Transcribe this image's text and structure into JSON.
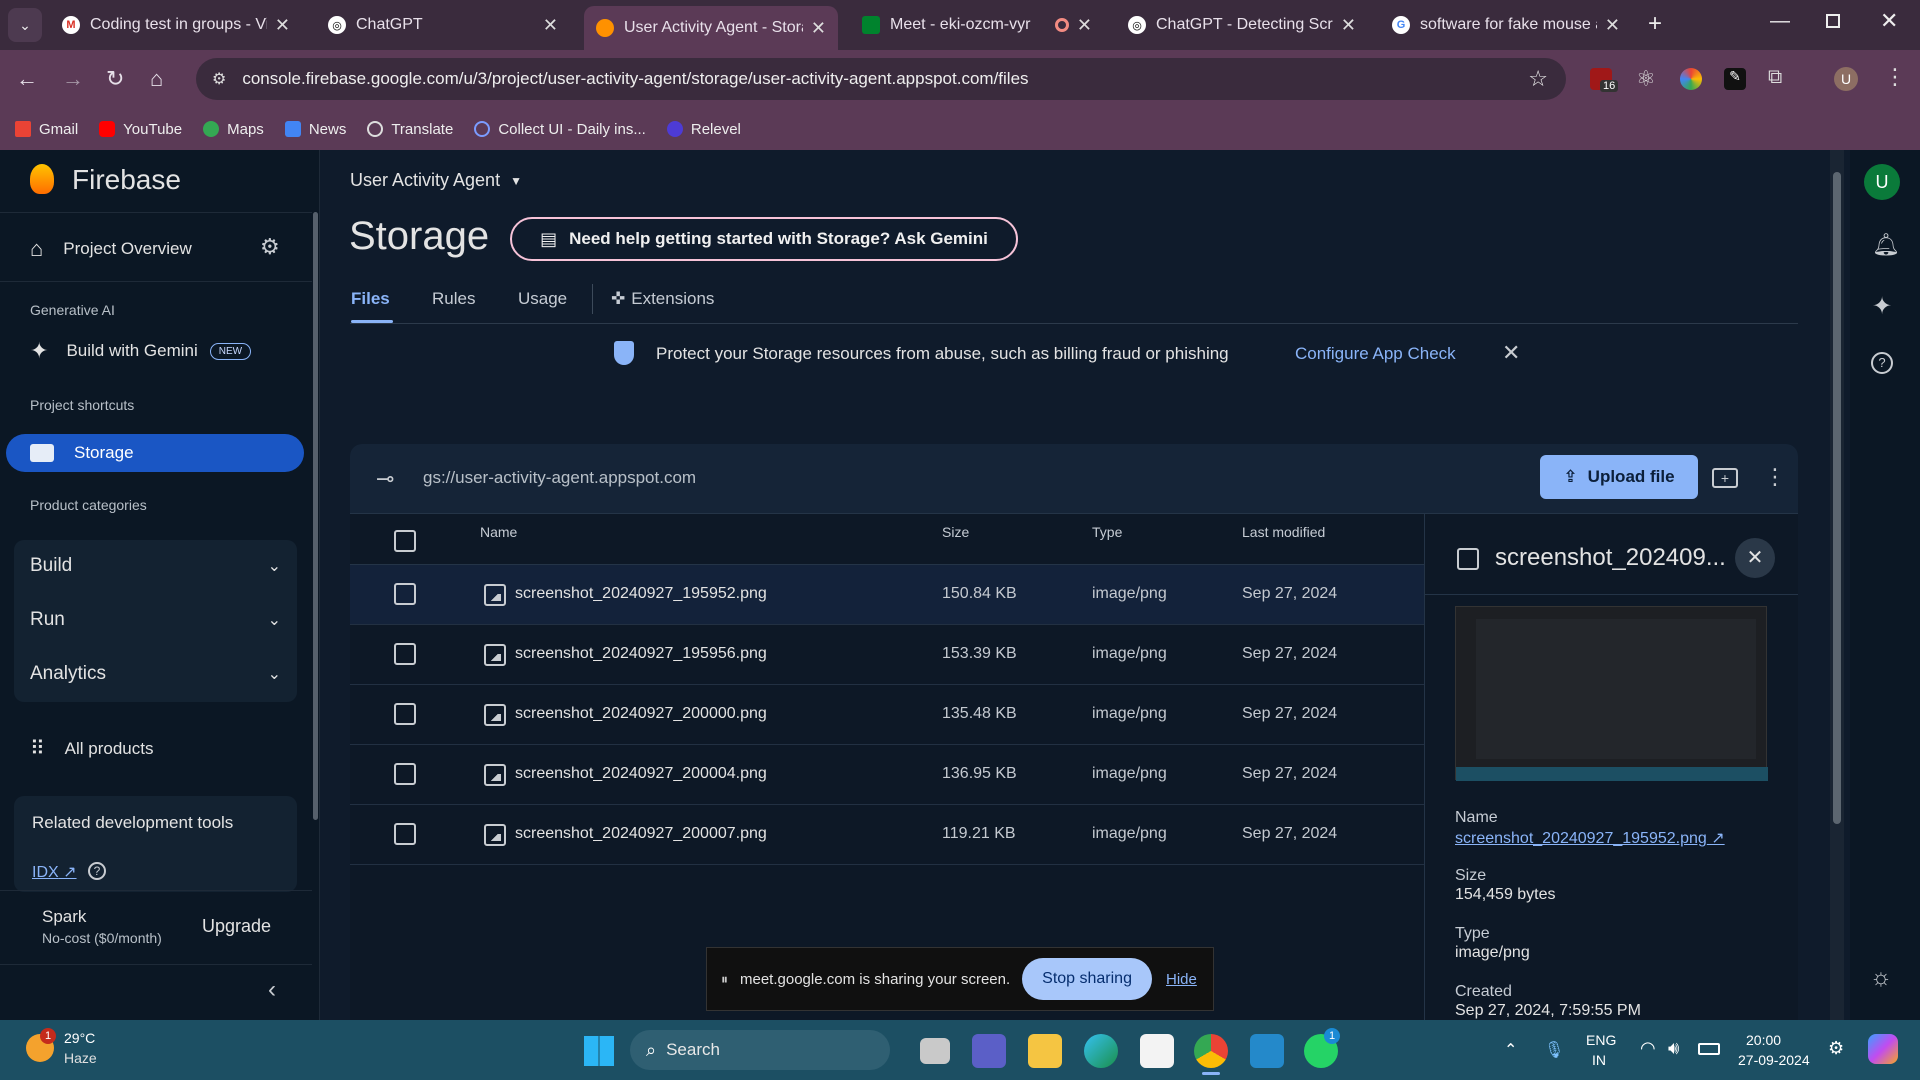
{
  "browser": {
    "tabs": [
      {
        "title": "Coding test in groups - Vin",
        "favicon": "gmail-icon",
        "active": false
      },
      {
        "title": "ChatGPT",
        "favicon": "chatgpt-icon",
        "active": false
      },
      {
        "title": "User Activity Agent - Stora",
        "favicon": "firebase-icon",
        "active": true
      },
      {
        "title": "Meet - eki-ozcm-vyr",
        "favicon": "meet-icon",
        "active": false
      },
      {
        "title": "ChatGPT - Detecting Script",
        "favicon": "chatgpt-icon",
        "active": false
      },
      {
        "title": "software for fake mouse an",
        "favicon": "google-icon",
        "active": false
      }
    ],
    "url": "console.firebase.google.com/u/3/project/user-activity-agent/storage/user-activity-agent.appspot.com/files",
    "extension_badge": "16",
    "profile_initial": "U",
    "bookmarks": [
      "Gmail",
      "YouTube",
      "Maps",
      "News",
      "Translate",
      "Collect UI - Daily ins...",
      "Relevel"
    ]
  },
  "sidebar": {
    "brand": "Firebase",
    "project_overview": "Project Overview",
    "generative_ai_heading": "Generative AI",
    "build_with_gemini": "Build with Gemini",
    "new_badge": "NEW",
    "project_shortcuts_heading": "Project shortcuts",
    "storage": "Storage",
    "product_categories_heading": "Product categories",
    "categories": [
      "Build",
      "Run",
      "Analytics"
    ],
    "all_products": "All products",
    "related_tools_heading": "Related development tools",
    "idx_link": "IDX",
    "plan_name": "Spark",
    "plan_desc": "No-cost ($0/month)",
    "upgrade": "Upgrade"
  },
  "header": {
    "project_name": "User Activity Agent",
    "page_title": "Storage",
    "gemini_help": "Need help getting started with Storage? Ask Gemini",
    "tabs": [
      "Files",
      "Rules",
      "Usage",
      "Extensions"
    ],
    "active_tab": "Files"
  },
  "banner": {
    "text": "Protect your Storage resources from abuse, such as billing fraud or phishing",
    "link": "Configure App Check"
  },
  "storage": {
    "bucket": "gs://user-activity-agent.appspot.com",
    "upload_button": "Upload file",
    "columns": [
      "Name",
      "Size",
      "Type",
      "Last modified"
    ],
    "files": [
      {
        "name": "screenshot_20240927_195952.png",
        "size": "150.84 KB",
        "type": "image/png",
        "modified": "Sep 27, 2024"
      },
      {
        "name": "screenshot_20240927_195956.png",
        "size": "153.39 KB",
        "type": "image/png",
        "modified": "Sep 27, 2024"
      },
      {
        "name": "screenshot_20240927_200000.png",
        "size": "135.48 KB",
        "type": "image/png",
        "modified": "Sep 27, 2024"
      },
      {
        "name": "screenshot_20240927_200004.png",
        "size": "136.95 KB",
        "type": "image/png",
        "modified": "Sep 27, 2024"
      },
      {
        "name": "screenshot_20240927_200007.png",
        "size": "119.21 KB",
        "type": "image/png",
        "modified": "Sep 27, 2024"
      }
    ]
  },
  "detail": {
    "title": "screenshot_202409...",
    "name_label": "Name",
    "name_value": "screenshot_20240927_195952.png",
    "size_label": "Size",
    "size_value": "154,459 bytes",
    "type_label": "Type",
    "type_value": "image/png",
    "created_label": "Created",
    "created_value": "Sep 27, 2024, 7:59:55 PM"
  },
  "screen_share": {
    "text": "meet.google.com is sharing your screen.",
    "stop": "Stop sharing",
    "hide": "Hide"
  },
  "taskbar": {
    "weather_temp": "29°C",
    "weather_desc": "Haze",
    "weather_badge": "1",
    "search": "Search",
    "lang_top": "ENG",
    "lang_bottom": "IN",
    "time": "20:00",
    "date": "27-09-2024",
    "whatsapp_badge": "1"
  },
  "colors": {
    "accent_blue": "#8ab4f8",
    "selected_nav": "#1a56c4",
    "upload_button": "#8ab4f8",
    "firebase_orange": "#ff9100"
  }
}
